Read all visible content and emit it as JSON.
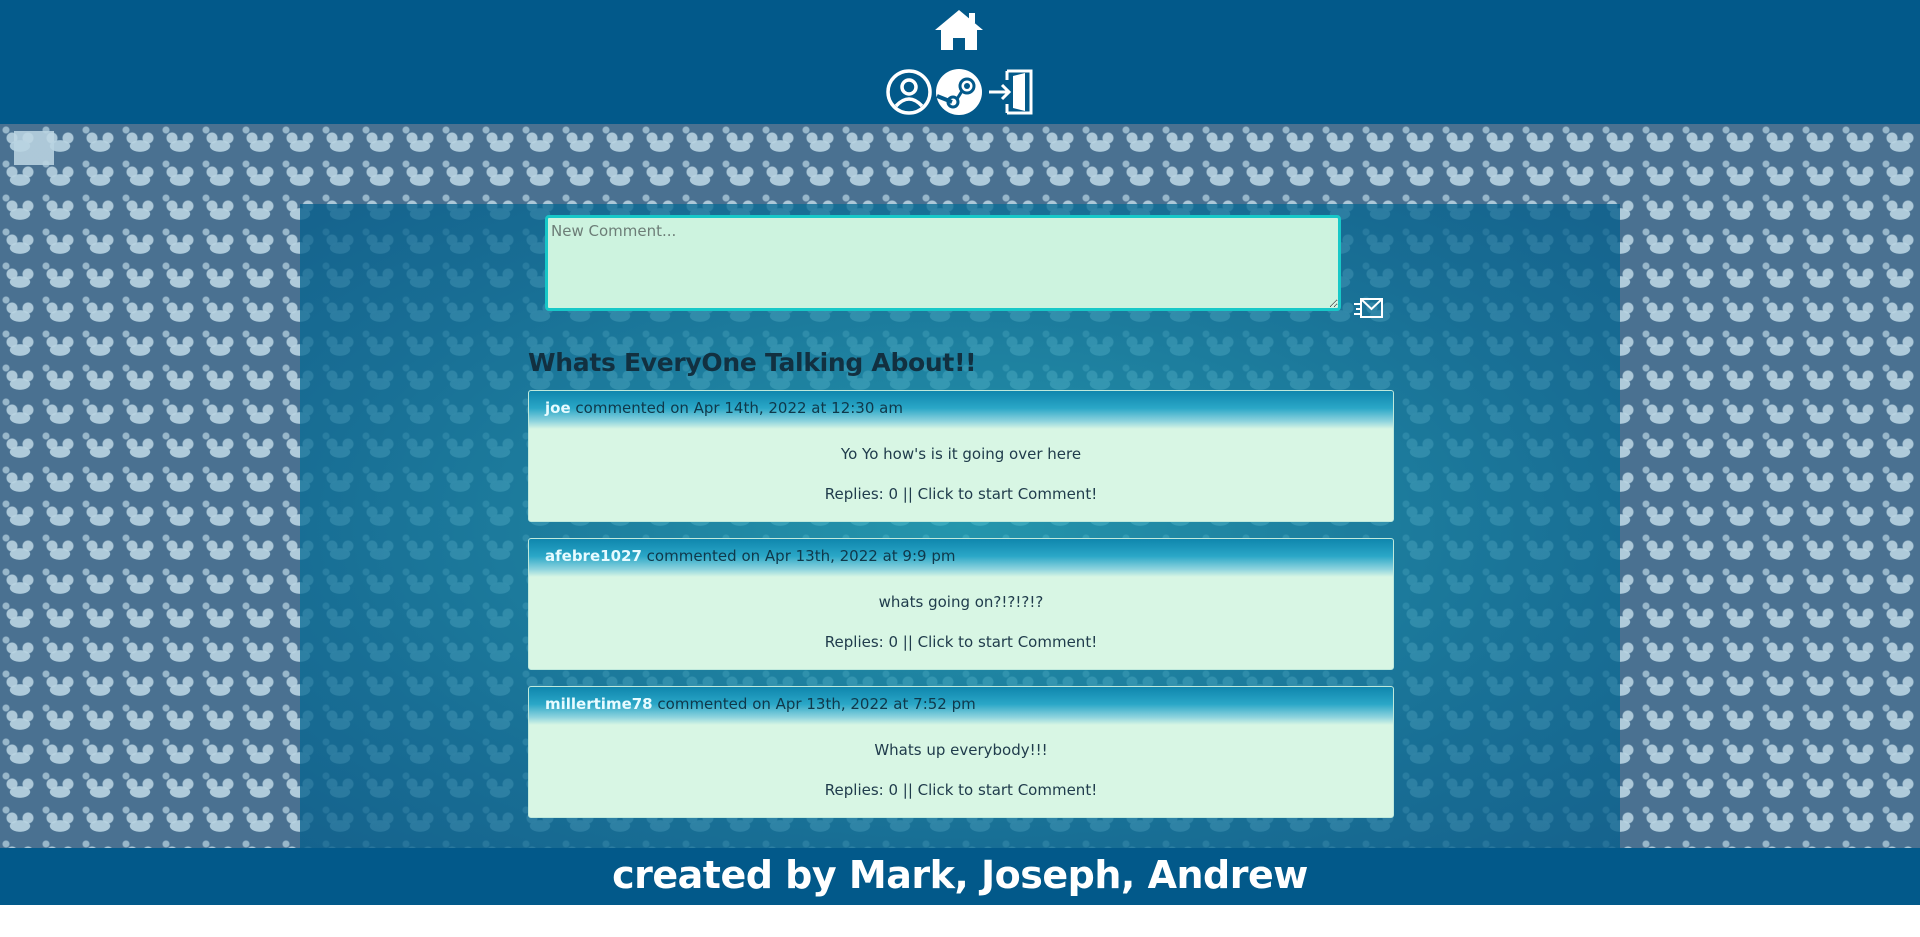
{
  "nav": {
    "home_icon": "home-icon",
    "icons": [
      "user-profile-icon",
      "steam-icon",
      "logout-door-icon"
    ]
  },
  "composer": {
    "placeholder": "New Comment...",
    "send_icon": "send-mail-icon"
  },
  "feed": {
    "title": "Whats EveryOne Talking About!!",
    "comments": [
      {
        "user": "joe",
        "meta": "commented on Apr 14th, 2022 at 12:30 am",
        "text": "Yo Yo how's is it going over here",
        "replies": "Replies: 0 || Click to start Comment!"
      },
      {
        "user": "afebre1027",
        "meta": "commented on Apr 13th, 2022 at 9:9 pm",
        "text": "whats going on?!?!?!?",
        "replies": "Replies: 0 || Click to start Comment!"
      },
      {
        "user": "millertime78",
        "meta": "commented on Apr 13th, 2022 at 7:52 pm",
        "text": "Whats up everybody!!!",
        "replies": "Replies: 0 || Click to start Comment!"
      }
    ]
  },
  "footer": {
    "text": "created by Mark, Joseph, Andrew"
  },
  "colors": {
    "header": "#02598a",
    "card": "#d8f6e4",
    "input": "#cdf3df",
    "accent": "#17c8c8"
  }
}
